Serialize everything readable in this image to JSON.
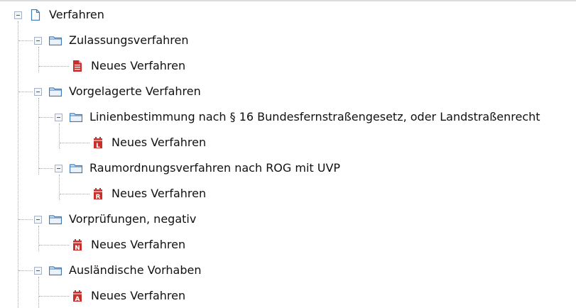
{
  "tree": {
    "root": {
      "label": "Verfahren",
      "icon": "document-icon",
      "children": [
        {
          "label": "Zulassungsverfahren",
          "icon": "folder-icon",
          "items": [
            {
              "label": "Neues Verfahren",
              "badge": "",
              "icon": "new-procedure-icon"
            }
          ]
        },
        {
          "label": "Vorgelagerte Verfahren",
          "icon": "folder-icon",
          "subfolders": [
            {
              "label": "Linienbestimmung nach § 16 Bundesfernstraßengesetz, oder Landstraßenrecht",
              "icon": "folder-icon",
              "items": [
                {
                  "label": "Neues Verfahren",
                  "badge": "L",
                  "icon": "new-procedure-l-icon"
                }
              ]
            },
            {
              "label": "Raumordnungsverfahren nach ROG mit UVP",
              "icon": "folder-icon",
              "items": [
                {
                  "label": "Neues Verfahren",
                  "badge": "R",
                  "icon": "new-procedure-r-icon"
                }
              ]
            }
          ]
        },
        {
          "label": "Vorprüfungen, negativ",
          "icon": "folder-icon",
          "items": [
            {
              "label": "Neues Verfahren",
              "badge": "N",
              "icon": "new-procedure-n-icon"
            }
          ]
        },
        {
          "label": "Ausländische Vorhaben",
          "icon": "folder-icon",
          "items": [
            {
              "label": "Neues Verfahren",
              "badge": "A",
              "icon": "new-procedure-a-icon"
            }
          ]
        }
      ]
    }
  },
  "colors": {
    "folder_stroke": "#3d7ab8",
    "folder_fill": "#eaf2fb",
    "document_stroke": "#3d7ab8",
    "procedure_red": "#c9302c",
    "toggle_border": "#a6b2c2",
    "connector": "#a8a8a8"
  }
}
